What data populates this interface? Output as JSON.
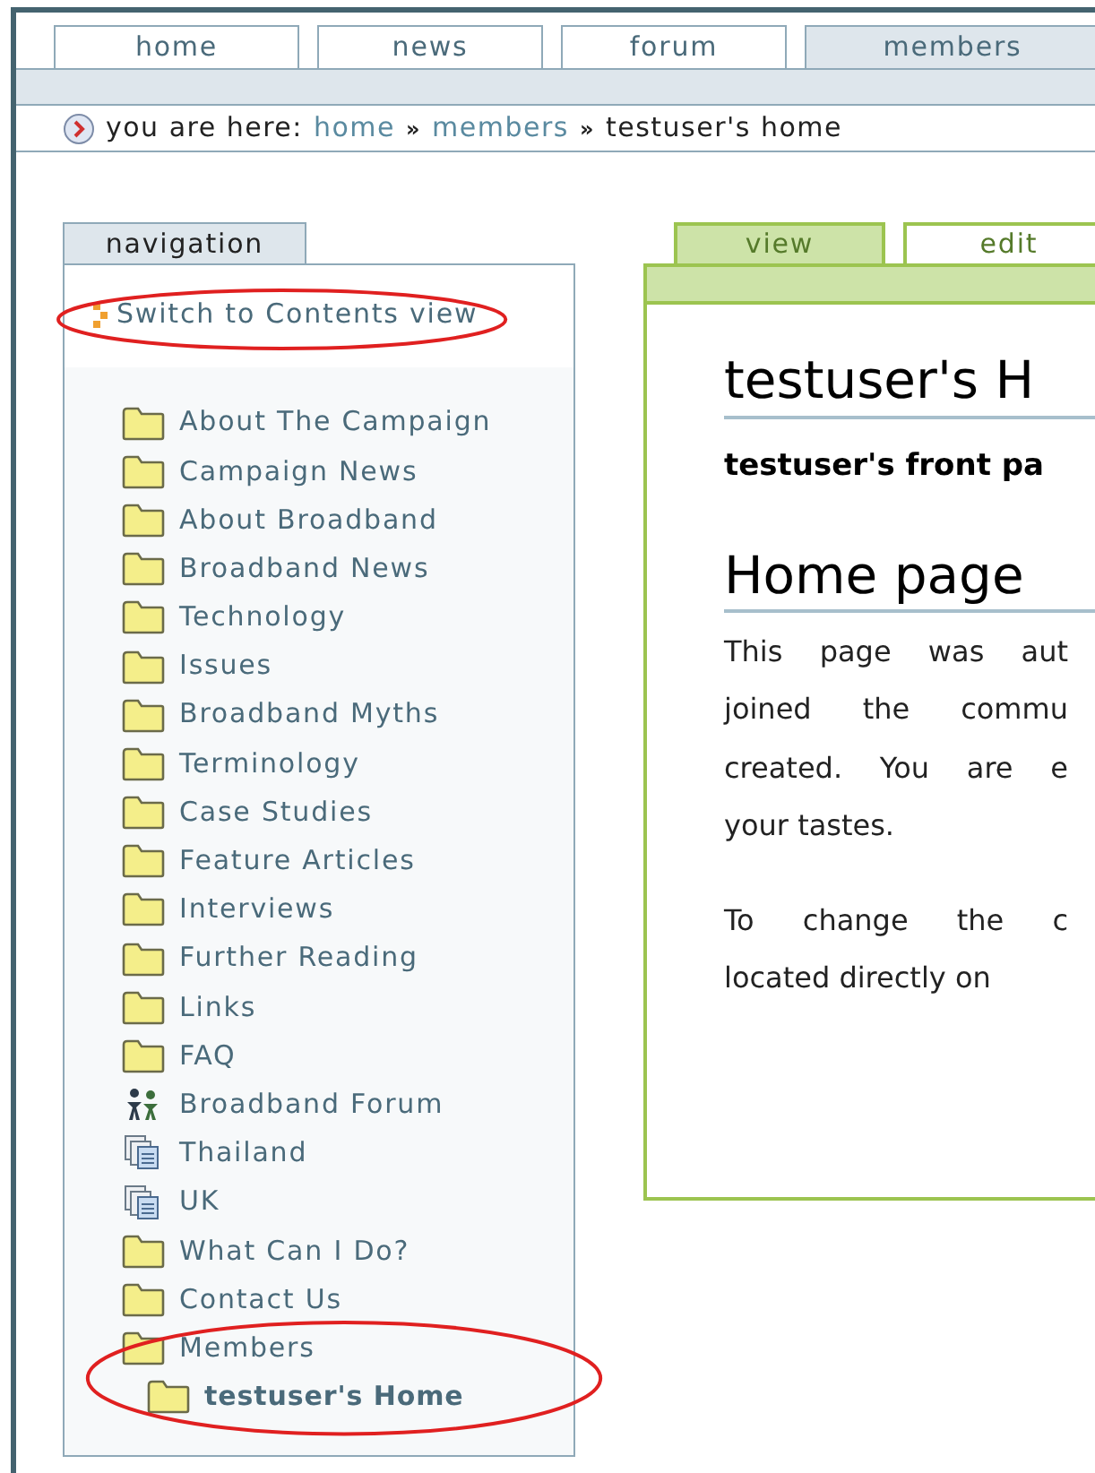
{
  "top_tabs": [
    {
      "label": "home",
      "selected": false
    },
    {
      "label": "news",
      "selected": false
    },
    {
      "label": "forum",
      "selected": false
    },
    {
      "label": "members",
      "selected": true
    }
  ],
  "breadcrumb": {
    "prefix": "you are here:",
    "links": [
      {
        "label": "home",
        "separator": "»"
      },
      {
        "label": "members",
        "separator": "»"
      }
    ],
    "current": "testuser's home"
  },
  "navigation": {
    "title": "navigation",
    "switch_link": {
      "label": "Switch to Contents view",
      "circled": true
    },
    "items": [
      {
        "label": "About The Campaign",
        "kind": "folder",
        "circled": false
      },
      {
        "label": "Campaign News",
        "kind": "folder",
        "circled": false
      },
      {
        "label": "About Broadband",
        "kind": "folder",
        "circled": false
      },
      {
        "label": "Broadband News",
        "kind": "folder",
        "circled": false
      },
      {
        "label": "Technology",
        "kind": "folder",
        "circled": false
      },
      {
        "label": "Issues",
        "kind": "folder",
        "circled": false
      },
      {
        "label": "Broadband Myths",
        "kind": "folder",
        "circled": false
      },
      {
        "label": "Terminology",
        "kind": "folder",
        "circled": false
      },
      {
        "label": "Case Studies",
        "kind": "folder",
        "circled": false
      },
      {
        "label": "Feature Articles",
        "kind": "folder",
        "circled": false
      },
      {
        "label": "Interviews",
        "kind": "folder",
        "circled": false
      },
      {
        "label": "Further Reading",
        "kind": "folder",
        "circled": false
      },
      {
        "label": "Links",
        "kind": "folder",
        "circled": false
      },
      {
        "label": "FAQ",
        "kind": "folder",
        "circled": false
      },
      {
        "label": "Broadband Forum",
        "kind": "people",
        "circled": false
      },
      {
        "label": "Thailand",
        "kind": "documents",
        "circled": false
      },
      {
        "label": "UK",
        "kind": "documents",
        "circled": false
      },
      {
        "label": "What Can I Do?",
        "kind": "folder",
        "circled": false
      },
      {
        "label": "Contact Us",
        "kind": "folder",
        "circled": false
      },
      {
        "label": "Members",
        "kind": "folder",
        "circled": true,
        "children": [
          {
            "label": "testuser's Home",
            "kind": "folder",
            "selected": true
          }
        ]
      }
    ]
  },
  "content_tabs": [
    {
      "label": "view",
      "selected": true
    },
    {
      "label": "edit",
      "selected": false
    }
  ],
  "content": {
    "title": "testuser's H",
    "description": "testuser's front pa",
    "heading": "Home page",
    "paragraphs": [
      [
        "This page was aut",
        "joined the commu",
        "created. You are e",
        "your tastes."
      ],
      [
        "To change the c",
        "located directly on"
      ]
    ]
  }
}
